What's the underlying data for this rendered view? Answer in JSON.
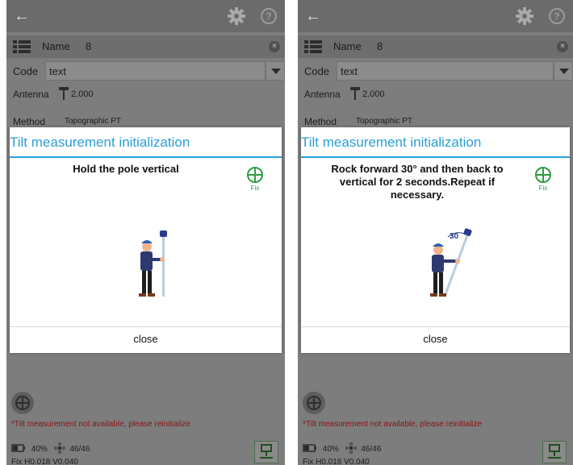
{
  "screens": [
    {
      "name_label": "Name",
      "name_value": "8",
      "code_label": "Code",
      "code_value": "text",
      "antenna_label": "Antenna",
      "antenna_value": "2.000",
      "method_label": "Method",
      "method_value": "Topographic PT",
      "dialog_title": "Tilt measurement initialization",
      "instruction": "Hold the pole vertical",
      "fix_label": "Fix",
      "close_label": "close",
      "warning": "*Tilt measurement not available, please reinitialize",
      "battery": "40%",
      "satellites": "46/46",
      "precision": "Fix H0.018 V0.040"
    },
    {
      "name_label": "Name",
      "name_value": "8",
      "code_label": "Code",
      "code_value": "text",
      "antenna_label": "Antenna",
      "antenna_value": "2.000",
      "method_label": "Method",
      "method_value": "Topographic PT",
      "dialog_title": "Tilt measurement initialization",
      "instruction": "Rock forward 30° and then back to vertical for 2 seconds.Repeat if necessary.",
      "tilt_angle_label": "30",
      "fix_label": "Fix",
      "close_label": "close",
      "warning": "*Tilt measurement not available, please reinitialize",
      "battery": "40%",
      "satellites": "46/46",
      "precision": "Fix H0.018 V0.040"
    }
  ],
  "icons": {
    "back": "arrow-left-icon",
    "settings": "gear-icon",
    "help": "question-icon",
    "list": "list-icon",
    "clear": "clear-icon",
    "antenna": "antenna-icon",
    "fix": "crosshair-icon",
    "target": "target-icon",
    "battery": "battery-icon",
    "satellite": "satellite-icon",
    "survey": "survey-icon"
  },
  "help_glyph": "?",
  "colors": {
    "accent": "#2a9fd6",
    "fix": "#2e9e44",
    "warning": "#8b1515",
    "background": "#7d7d7d"
  }
}
